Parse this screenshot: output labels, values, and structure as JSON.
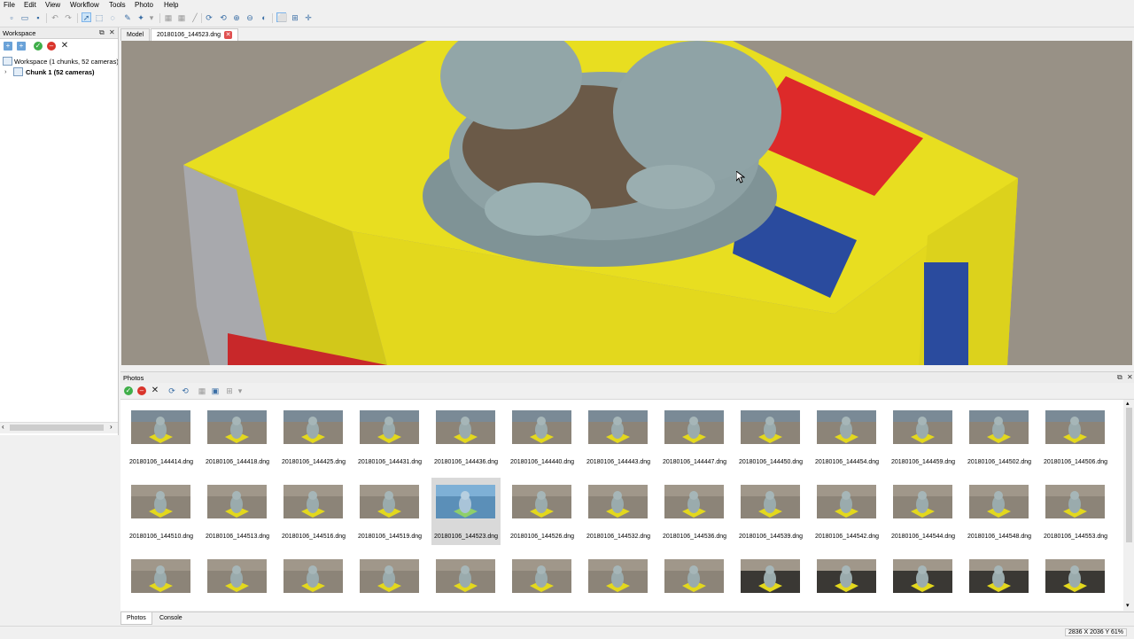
{
  "menu": [
    "File",
    "Edit",
    "View",
    "Workflow",
    "Tools",
    "Photo",
    "Help"
  ],
  "workspace_panel": {
    "title": "Workspace",
    "tree": [
      {
        "label": "Workspace (1 chunks, 52 cameras)"
      },
      {
        "label": "Chunk 1 (52 cameras)"
      }
    ]
  },
  "model_tabs": [
    {
      "label": "Model"
    },
    {
      "label": "20180106_144523.dng"
    }
  ],
  "photos_panel": {
    "title": "Photos",
    "selected": "20180106_144523.dng",
    "photos": [
      {
        "name": "20180106_144414.dng"
      },
      {
        "name": "20180106_144418.dng"
      },
      {
        "name": "20180106_144425.dng"
      },
      {
        "name": "20180106_144431.dng"
      },
      {
        "name": "20180106_144436.dng"
      },
      {
        "name": "20180106_144440.dng"
      },
      {
        "name": "20180106_144443.dng"
      },
      {
        "name": "20180106_144447.dng"
      },
      {
        "name": "20180106_144450.dng"
      },
      {
        "name": "20180106_144454.dng"
      },
      {
        "name": "20180106_144459.dng"
      },
      {
        "name": "20180106_144502.dng"
      },
      {
        "name": "20180106_144506.dng"
      },
      {
        "name": "20180106_144510.dng"
      },
      {
        "name": "20180106_144513.dng"
      },
      {
        "name": "20180106_144516.dng"
      },
      {
        "name": "20180106_144519.dng"
      },
      {
        "name": "20180106_144523.dng"
      },
      {
        "name": "20180106_144526.dng"
      },
      {
        "name": "20180106_144532.dng"
      },
      {
        "name": "20180106_144536.dng"
      },
      {
        "name": "20180106_144539.dng"
      },
      {
        "name": "20180106_144542.dng"
      },
      {
        "name": "20180106_144544.dng"
      },
      {
        "name": "20180106_144548.dng"
      },
      {
        "name": "20180106_144553.dng"
      },
      {
        "name": ""
      },
      {
        "name": ""
      },
      {
        "name": ""
      },
      {
        "name": ""
      },
      {
        "name": ""
      },
      {
        "name": ""
      },
      {
        "name": ""
      },
      {
        "name": ""
      },
      {
        "name": ""
      },
      {
        "name": ""
      },
      {
        "name": ""
      },
      {
        "name": ""
      },
      {
        "name": ""
      }
    ]
  },
  "bottom_tabs": [
    {
      "label": "Photos"
    },
    {
      "label": "Console"
    }
  ],
  "status": {
    "coords": "2836 X 2036 Y 61%"
  },
  "icons": {
    "toolbar": [
      "new-file-icon",
      "open-folder-icon",
      "save-icon",
      "undo-icon",
      "redo-icon",
      "navigation-icon",
      "rectangle-select-icon",
      "free-form-select-icon",
      "ruler-icon",
      "magic-wand-icon",
      "reset-view-icon",
      "zoom-in-icon",
      "zoom-out-icon",
      "rotate-icon",
      "fit-icon",
      "grid-icon",
      "move-icon"
    ],
    "workspace": [
      "add-chunk-icon",
      "add-photos-icon",
      "enable-icon",
      "disable-icon",
      "remove-icon"
    ],
    "photos": [
      "enable-icon",
      "disable-icon",
      "remove-icon",
      "rotate-right-icon",
      "rotate-left-icon",
      "reset-filter-icon",
      "show-cameras-icon",
      "view-mode-icon"
    ]
  },
  "colors": {
    "accent": "#3a6ea5",
    "box_yellow": "#ece51e",
    "statue": "#8fa3a6",
    "selection": "#d9d9d9"
  }
}
